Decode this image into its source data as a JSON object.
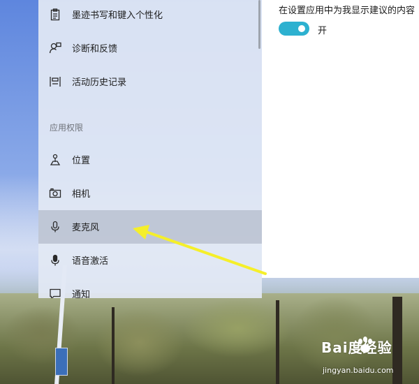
{
  "main_panel": {
    "suggestion_text": "在设置应用中为我显示建议的内容",
    "toggle_state": "开",
    "toggle_color": "#2db1d0"
  },
  "sidebar": {
    "items_top": [
      {
        "label": "墨迹书写和键入个性化",
        "icon": "clipboard-icon"
      },
      {
        "label": "诊断和反馈",
        "icon": "person-feedback-icon"
      },
      {
        "label": "活动历史记录",
        "icon": "timeline-icon"
      }
    ],
    "section_header": "应用权限",
    "items_permissions": [
      {
        "label": "位置",
        "icon": "location-icon"
      },
      {
        "label": "相机",
        "icon": "camera-icon"
      },
      {
        "label": "麦克风",
        "icon": "microphone-icon",
        "selected": true
      },
      {
        "label": "语音激活",
        "icon": "voice-activation-icon"
      },
      {
        "label": "通知",
        "icon": "notification-icon"
      }
    ]
  },
  "annotation": {
    "color": "#f5ef2a",
    "target": "麦克风"
  },
  "watermark": {
    "brand": "Bai度经验",
    "url": "jingyan.baidu.com"
  }
}
